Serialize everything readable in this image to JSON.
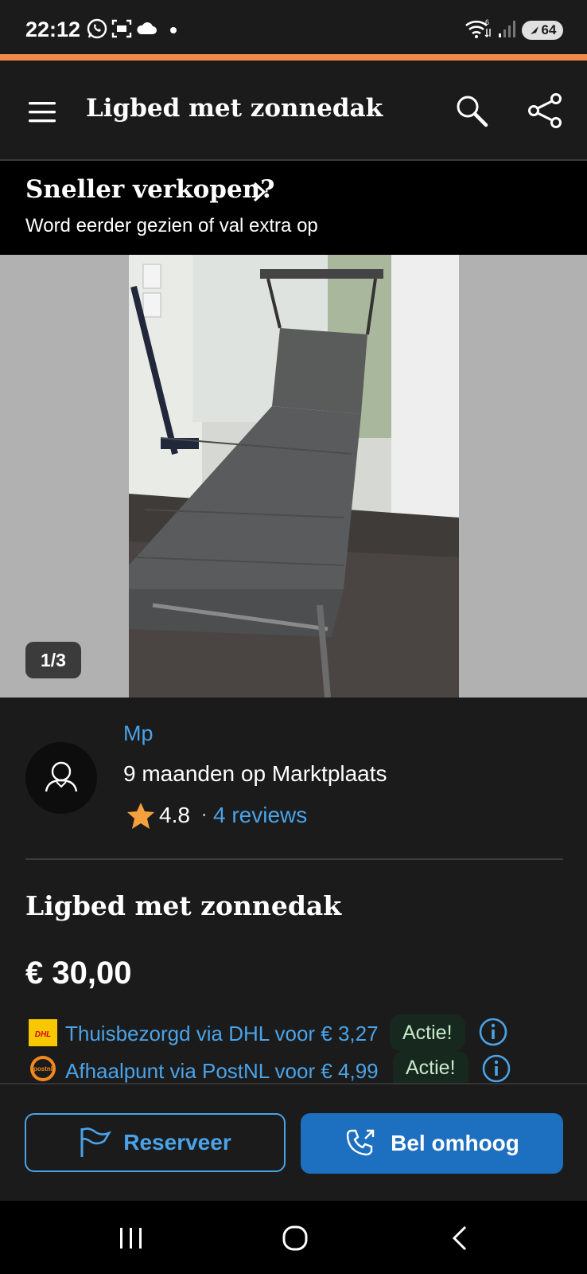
{
  "status_bar": {
    "time": "22:12",
    "battery": "64",
    "left_icons": [
      "whatsapp-icon",
      "screenshot-icon",
      "cloud-icon",
      "dot-icon"
    ],
    "right_icons": [
      "wifi-icon",
      "signal-icon",
      "battery-icon"
    ]
  },
  "app_bar": {
    "title": "Ligbed met zonnedak",
    "icons": [
      "menu-icon",
      "search-icon",
      "share-icon"
    ]
  },
  "promo": {
    "title": "Sneller verkopen?",
    "subtitle": "Word eerder gezien of val extra op"
  },
  "gallery": {
    "counter": "1/3"
  },
  "seller": {
    "name": "Mp",
    "since": "9 maanden op Marktplaats",
    "rating": "4.8",
    "separator": "·",
    "reviews": "4 reviews"
  },
  "listing": {
    "title": "Ligbed met zonnedak",
    "price": "€ 30,00"
  },
  "shipping": [
    {
      "logo": "DHL",
      "text": "Thuisbezorgd via DHL voor € 3,27",
      "badge": "Actie!"
    },
    {
      "logo": "postnl",
      "text": "Afhaalpunt via PostNL voor € 4,99",
      "badge": "Actie!"
    }
  ],
  "actions": {
    "reserve": "Reserveer",
    "call": "Bel omhoog"
  },
  "colors": {
    "accent_orange": "#f08a4b",
    "link_blue": "#4aa3e8",
    "button_blue": "#1d6fbf",
    "background": "#1b1b1b",
    "star": "#f5a03c"
  }
}
